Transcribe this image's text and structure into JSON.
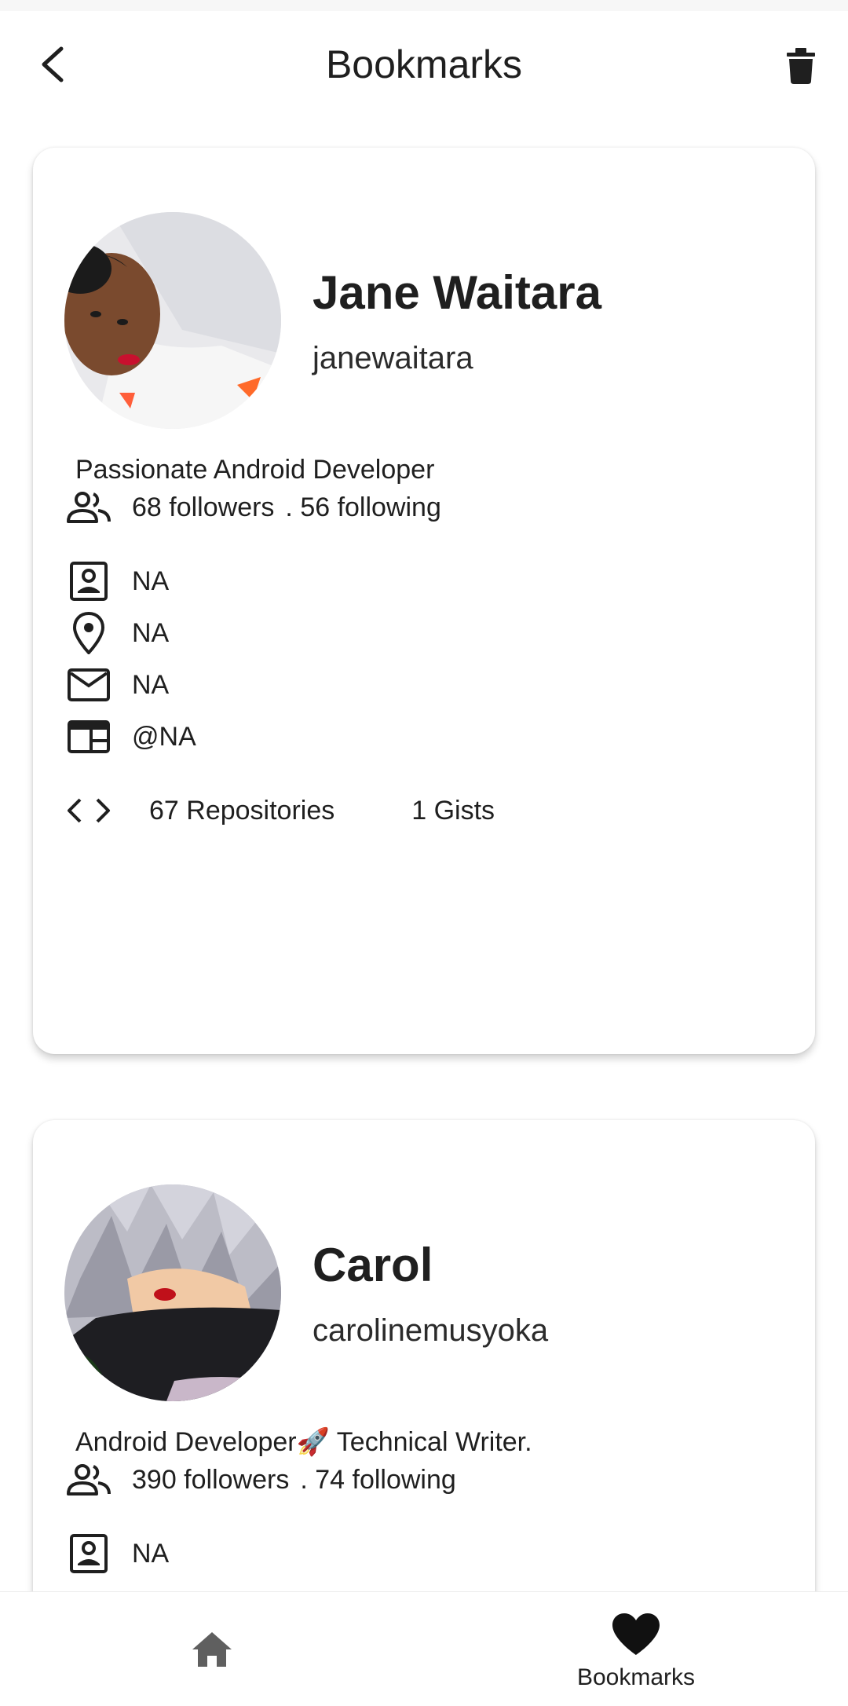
{
  "header": {
    "title": "Bookmarks",
    "back_icon": "arrow-back-icon",
    "delete_icon": "trash-icon"
  },
  "bookmarks": [
    {
      "name": "Jane Waitara",
      "username": "janewaitara",
      "bio": "Passionate Android Developer",
      "followers": "68 followers",
      "following": ". 56 following",
      "company": "NA",
      "location": "NA",
      "email": "NA",
      "twitter": "@NA",
      "repositories": "67 Repositories",
      "gists": "1 Gists"
    },
    {
      "name": "Carol",
      "username": "carolinemusyoka",
      "bio": "Android Developer🚀 Technical Writer.",
      "followers": "390 followers",
      "following": ". 74 following",
      "company": "NA"
    }
  ],
  "bottom_nav": {
    "home_icon": "home-icon",
    "bookmarks_icon": "heart-icon",
    "bookmarks_label": "Bookmarks"
  },
  "colors": {
    "icon": "#1f1f1f",
    "nav_inactive": "#5f5f5f",
    "card_bg": "#ffffff"
  }
}
